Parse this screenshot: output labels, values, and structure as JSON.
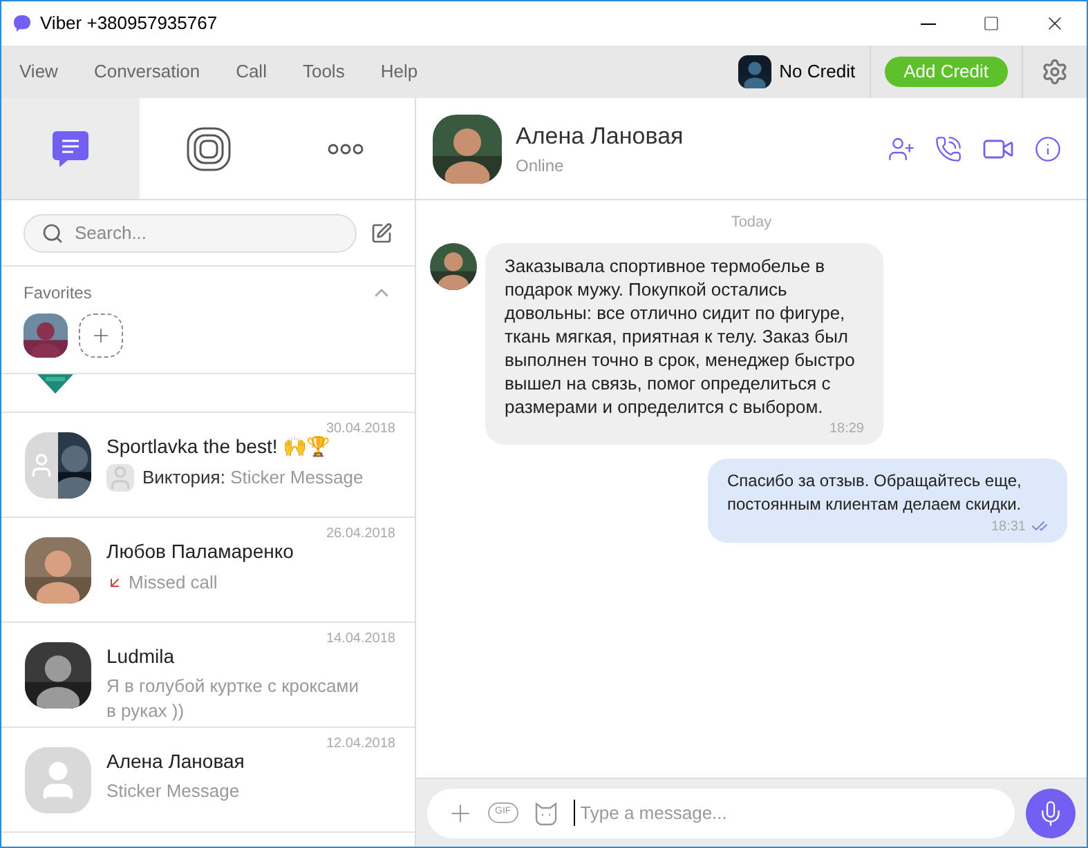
{
  "window": {
    "title": "Viber +380957935767"
  },
  "menu": [
    "View",
    "Conversation",
    "Call",
    "Tools",
    "Help"
  ],
  "credit": {
    "label": "No Credit",
    "button": "Add Credit"
  },
  "left_tabs": [
    {
      "kind": "chats",
      "selected": true
    },
    {
      "kind": "stories",
      "selected": false
    },
    {
      "kind": "more",
      "selected": false
    }
  ],
  "search": {
    "placeholder": "Search..."
  },
  "favorites": {
    "title": "Favorites",
    "expanded": true
  },
  "chats": [
    {
      "name": "Sportlavka the best! 🙌🏆",
      "date": "30.04.2018",
      "sender": "Виктория:",
      "preview": "Sticker Message",
      "kind": "group"
    },
    {
      "name": "Любов Паламаренко",
      "date": "26.04.2018",
      "preview": "Missed call",
      "kind": "missed"
    },
    {
      "name": "Ludmila",
      "date": "14.04.2018",
      "preview": "Я в голубой куртке с кроксами в руках ))"
    },
    {
      "name": "Алена Лановая",
      "date": "12.04.2018",
      "preview": "Sticker Message",
      "kind": "placeholder"
    }
  ],
  "contact": {
    "name": "Алена Лановая",
    "status": "Online"
  },
  "day": "Today",
  "messages": [
    {
      "kind": "incoming",
      "text": "Заказывала спортивное термобелье в подарок мужу. Покупкой остались довольны: все отлично сидит по фигуре, ткань мягкая, приятная к телу. Заказ был выполнен точно в срок, менеджер быстро вышел на связь, помог определиться с размерами и определится с выбором.",
      "time": "18:29"
    },
    {
      "kind": "outgoing",
      "text": "Спасибо за отзыв. Обращайтесь еще, постоянным клиентам делаем скидки.",
      "time": "18:31",
      "read": true
    }
  ],
  "composer": {
    "placeholder": "Type a message...",
    "gif": "GIF"
  }
}
